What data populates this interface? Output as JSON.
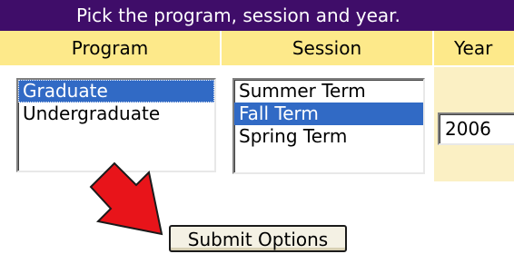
{
  "header": {
    "title": "Pick the program, session and year."
  },
  "columns": {
    "program": "Program",
    "session": "Session",
    "year": "Year"
  },
  "program_list": {
    "items": [
      "Graduate",
      "Undergraduate"
    ],
    "selected": "Graduate"
  },
  "session_list": {
    "items": [
      "Summer Term",
      "Fall Term",
      "Spring Term"
    ],
    "selected": "Fall Term"
  },
  "year_select": {
    "value": "2006"
  },
  "submit": {
    "label": "Submit Options"
  },
  "colors": {
    "header_bg": "#3f0d69",
    "column_header_bg": "#fde98a",
    "year_cell_bg": "#fbf0c4",
    "selection": "#316ac5",
    "arrow_fill": "#e8141a"
  },
  "icons": {
    "pointer_arrow": "red-pointer-arrow-icon"
  }
}
